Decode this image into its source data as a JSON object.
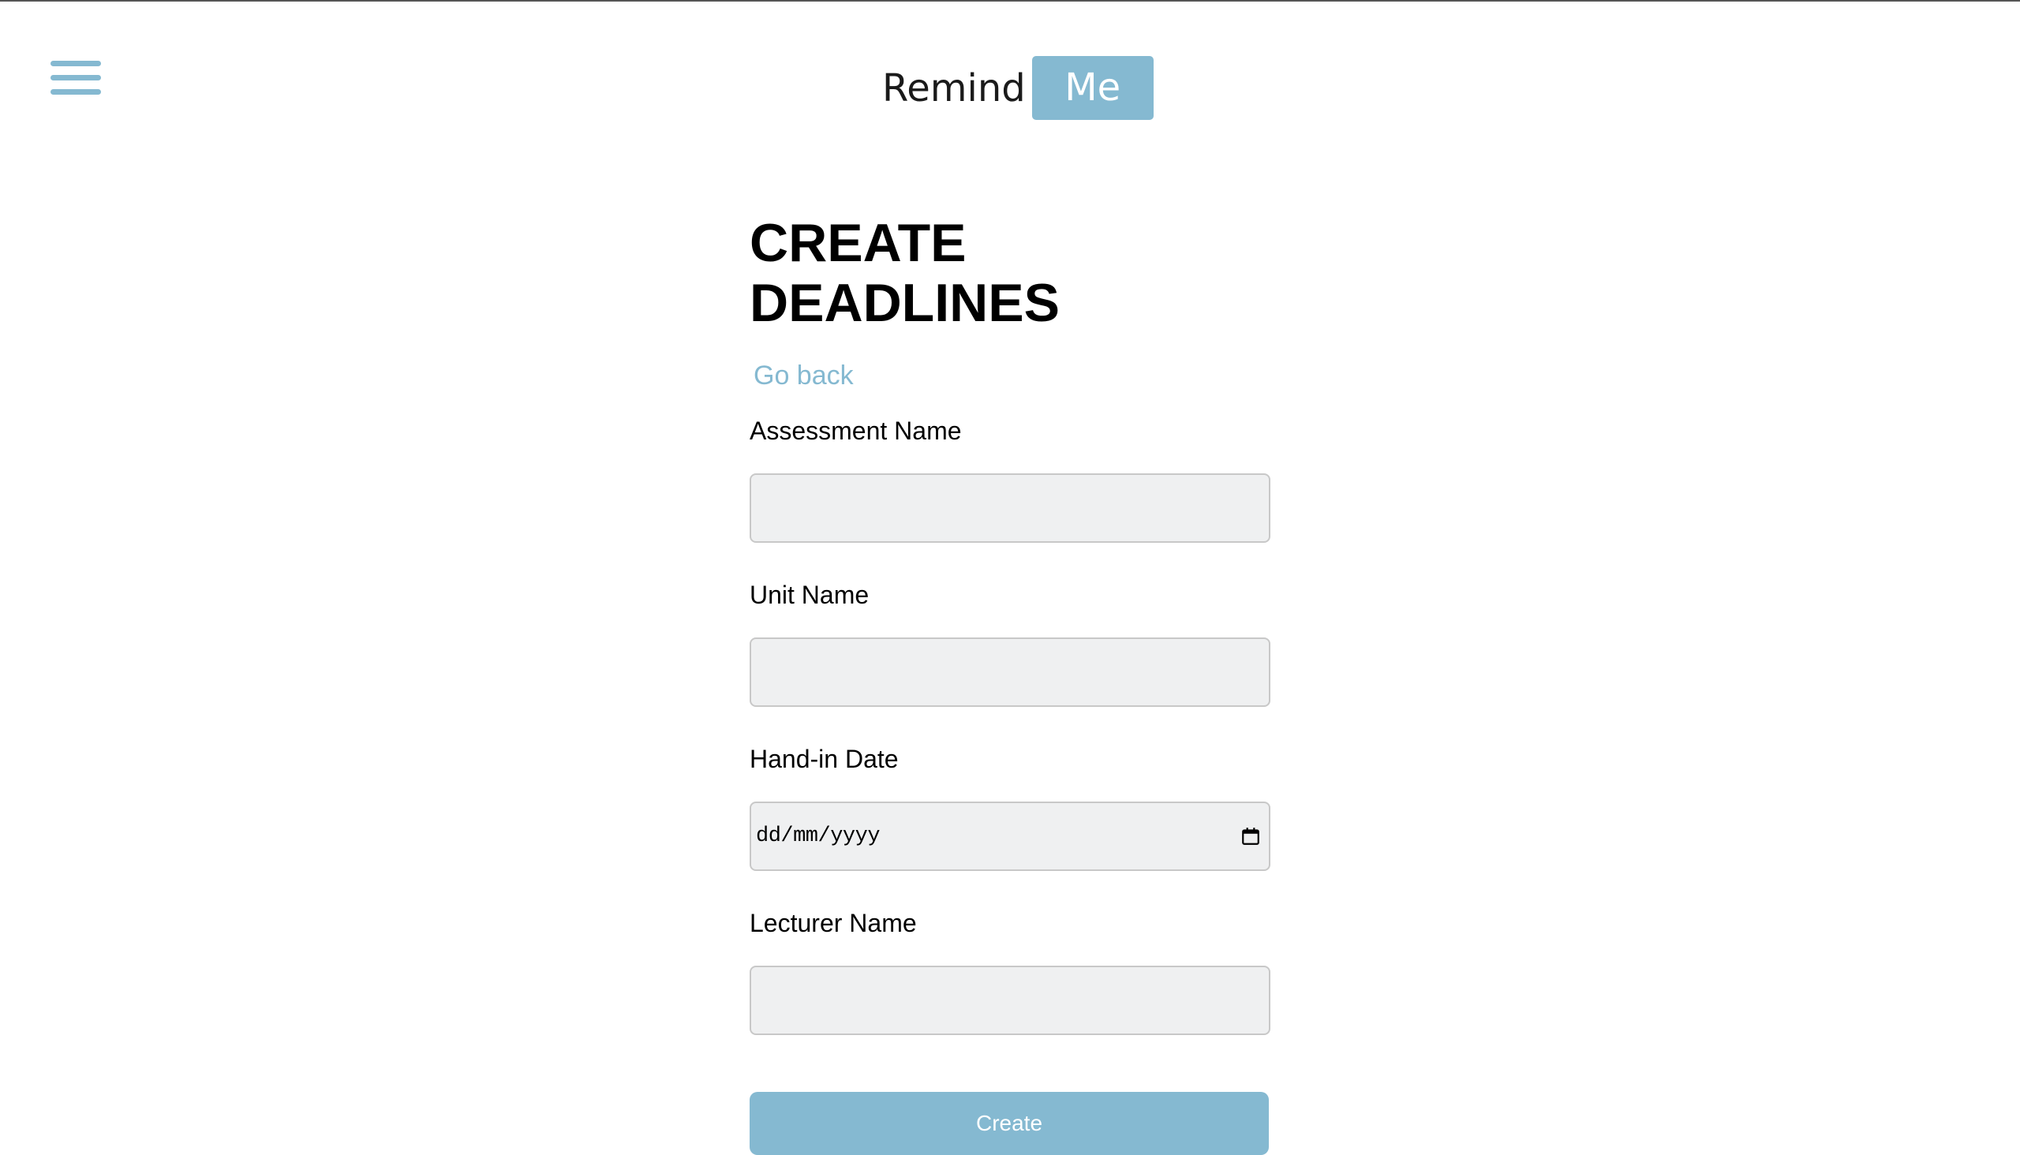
{
  "header": {
    "menu_icon": "hamburger-menu-icon",
    "logo_part1": "Remind",
    "logo_part2": "Me"
  },
  "main": {
    "title": "CREATE DEADLINES",
    "go_back": "Go back",
    "fields": {
      "assessment_name": {
        "label": "Assessment Name",
        "value": ""
      },
      "unit_name": {
        "label": "Unit Name",
        "value": ""
      },
      "hand_in_date": {
        "label": "Hand-in Date",
        "placeholder": "dd/mm/yyyy",
        "icon": "calendar-icon"
      },
      "lecturer_name": {
        "label": "Lecturer Name",
        "value": ""
      }
    },
    "create_button": "Create"
  },
  "colors": {
    "accent": "#85b9d1",
    "field_background": "#eff0f1",
    "text": "#000000"
  }
}
